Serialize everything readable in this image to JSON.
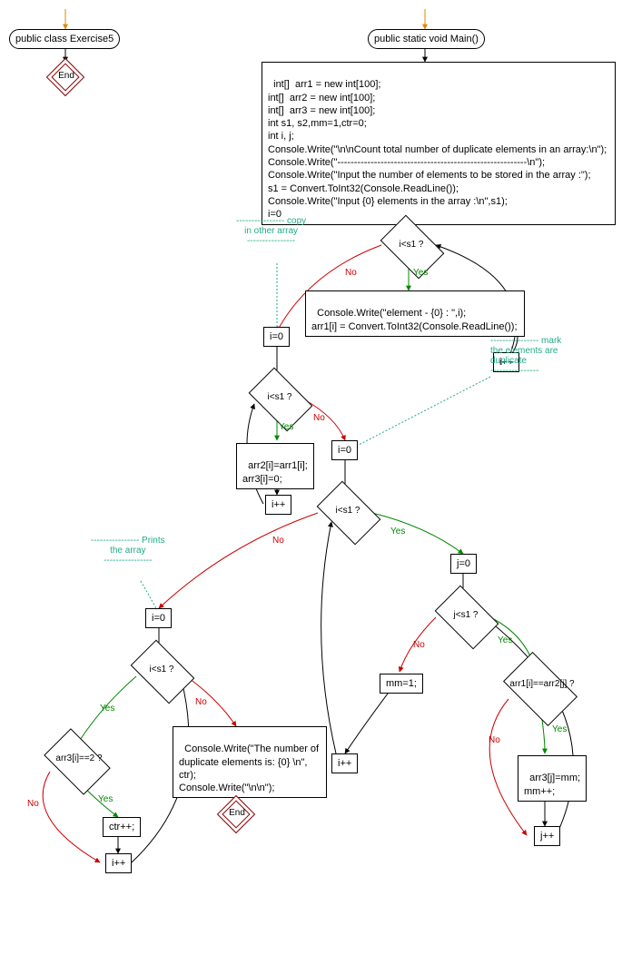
{
  "left_class": {
    "label": "public class Exercise5",
    "end": "End"
  },
  "main_method": {
    "label": "public static void Main()",
    "init_block": "int[]  arr1 = new int[100];\nint[]  arr2 = new int[100];\nint[]  arr3 = new int[100];\nint s1, s2,mm=1,ctr=0;\nint i, j;\nConsole.Write(\"\\n\\nCount total number of duplicate elements in an array:\\n\");\nConsole.Write(\"---------------------------------------------------------\\n\");\nConsole.Write(\"Input the number of elements to be stored in the array :\");\ns1 = Convert.ToInt32(Console.ReadLine());\nConsole.Write(\"Input {0} elements in the array :\\n\",s1);\ni=0",
    "loop1_cond": "i<s1 ?",
    "loop1_body": "Console.Write(\"element - {0} : \",i);\narr1[i] = Convert.ToInt32(Console.ReadLine());",
    "loop1_inc": "i++",
    "i0": "i=0",
    "loop2_cond": "i<s1 ?",
    "loop2_body": "arr2[i]=arr1[i];\narr3[i]=0;",
    "loop2_inc": "i++",
    "j0": "j=0",
    "loop3_cond": "i<s1 ?",
    "loop4_cond": "j<s1 ?",
    "mm1": "mm=1;",
    "eqcond": "arr1[i]==arr2[j] ?",
    "eqbody": "arr3[j]=mm;\nmm++;",
    "jinc": "j++",
    "iinc": "i++",
    "loop5_cond": "i<s1 ?",
    "eq2cond": "arr3[i]==2 ?",
    "ctr": "ctr++;",
    "out_block": "Console.Write(\"The number of\nduplicate elements is: {0} \\n\", ctr);\nConsole.Write(\"\\n\\n\");",
    "end": "End"
  },
  "comments": {
    "copy": "---------------- copy\nin other array\n----------------",
    "mark": "---------------- mark\nthe elements are\nduplicate\n----------------",
    "prints": "---------------- Prints\nthe array\n----------------"
  },
  "labels": {
    "yes": "Yes",
    "no": "No"
  }
}
